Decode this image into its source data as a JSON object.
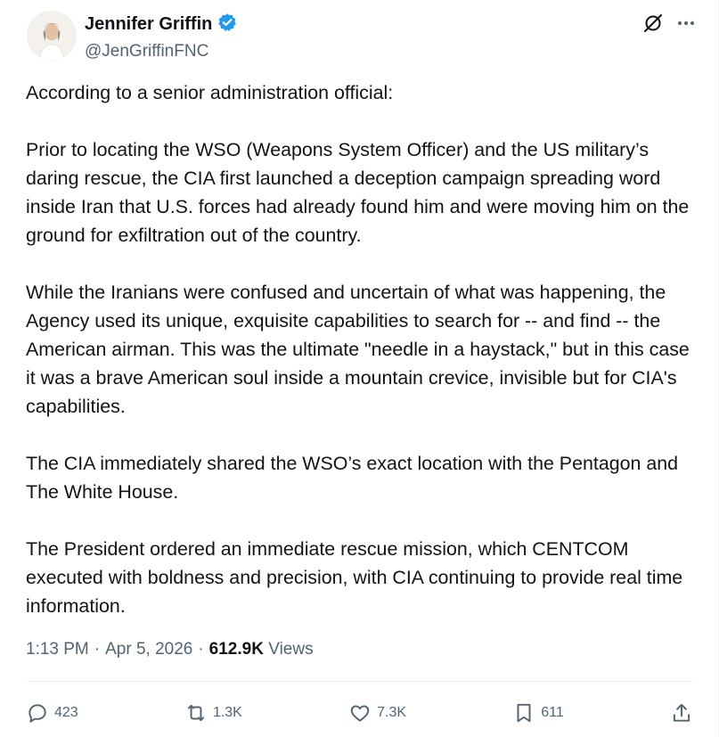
{
  "author": {
    "name": "Jennifer Griffin",
    "handle": "@JenGriffinFNC",
    "verified": true
  },
  "icons": {
    "verified": "verified-badge-icon",
    "grok": "grok-icon",
    "more": "more-icon",
    "reply": "reply-icon",
    "repost": "repost-icon",
    "like": "like-icon",
    "bookmark": "bookmark-icon",
    "share": "share-icon"
  },
  "colors": {
    "verified": "#1d9bf0",
    "text": "#0f1419",
    "secondary": "#536471"
  },
  "tweet": {
    "paragraphs": [
      "According to a senior administration official:",
      "Prior to locating the WSO (Weapons System Officer) and the US military’s daring rescue, the CIA first launched a deception campaign spreading word inside Iran that U.S. forces had already found him and were moving him on the ground for exfiltration out of the country.",
      "While the Iranians were confused and uncertain of what was happening, the Agency used its unique, exquisite capabilities to search for -- and find -- the American airman. This was the ultimate \"needle in a haystack,\" but in this case it was a brave American soul inside a mountain crevice, invisible but for CIA's capabilities.",
      "The CIA immediately shared the WSO’s exact location with the Pentagon and The White House.",
      "The President ordered an immediate rescue mission, which CENTCOM executed with boldness and precision, with CIA continuing to provide real time information."
    ]
  },
  "meta": {
    "time": "1:13 PM",
    "date": "Apr 5, 2026",
    "views_count": "612.9K",
    "views_label": "Views",
    "separator": "·"
  },
  "actions": {
    "replies": "423",
    "reposts": "1.3K",
    "likes": "7.3K",
    "bookmarks": "611"
  }
}
